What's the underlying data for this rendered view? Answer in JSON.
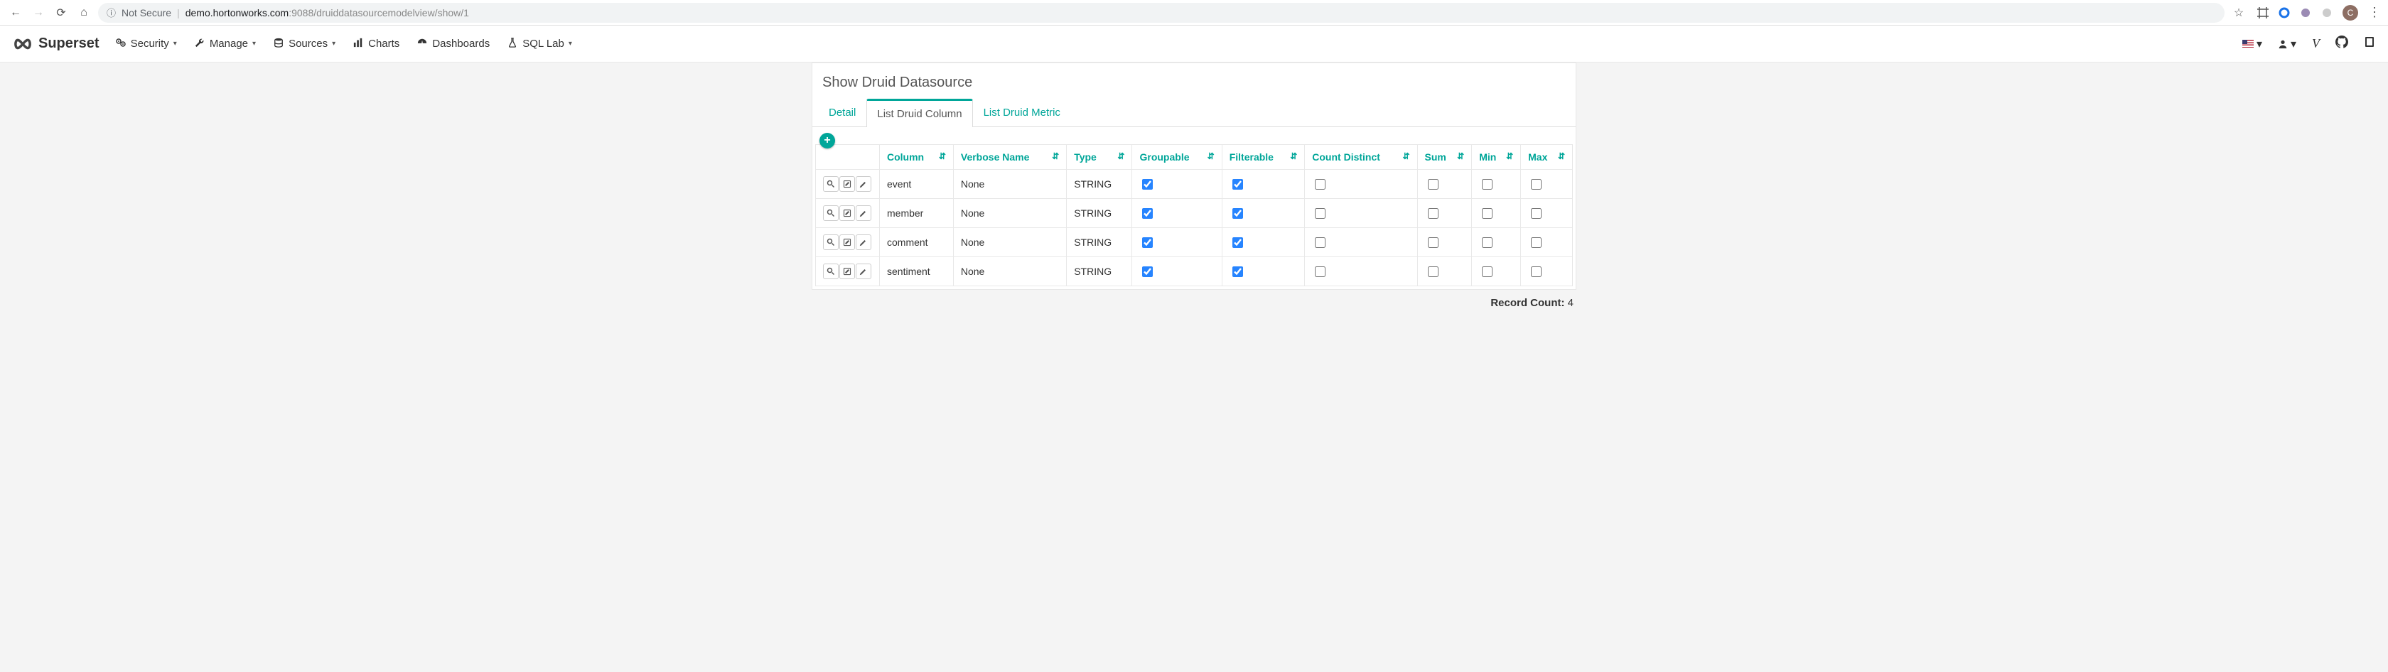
{
  "browser": {
    "not_secure": "Not Secure",
    "domain": "demo.hortonworks.com",
    "port_path": ":9088/druiddatasourcemodelview/show/1",
    "avatar_letter": "C"
  },
  "nav": {
    "brand": "Superset",
    "items": [
      {
        "label": "Security",
        "icon": "cogs"
      },
      {
        "label": "Manage",
        "icon": "wrench"
      },
      {
        "label": "Sources",
        "icon": "database"
      },
      {
        "label": "Charts",
        "icon": "bar-chart"
      },
      {
        "label": "Dashboards",
        "icon": "dashboard"
      },
      {
        "label": "SQL Lab",
        "icon": "flask"
      }
    ]
  },
  "page": {
    "title": "Show Druid Datasource",
    "tabs": [
      {
        "label": "Detail",
        "active": false
      },
      {
        "label": "List Druid Column",
        "active": true
      },
      {
        "label": "List Druid Metric",
        "active": false
      }
    ]
  },
  "table": {
    "headers": [
      "Column",
      "Verbose Name",
      "Type",
      "Groupable",
      "Filterable",
      "Count Distinct",
      "Sum",
      "Min",
      "Max"
    ],
    "rows": [
      {
        "column": "event",
        "verbose": "None",
        "type": "STRING",
        "groupable": true,
        "filterable": true,
        "count_distinct": false,
        "sum": false,
        "min": false,
        "max": false
      },
      {
        "column": "member",
        "verbose": "None",
        "type": "STRING",
        "groupable": true,
        "filterable": true,
        "count_distinct": false,
        "sum": false,
        "min": false,
        "max": false
      },
      {
        "column": "comment",
        "verbose": "None",
        "type": "STRING",
        "groupable": true,
        "filterable": true,
        "count_distinct": false,
        "sum": false,
        "min": false,
        "max": false
      },
      {
        "column": "sentiment",
        "verbose": "None",
        "type": "STRING",
        "groupable": true,
        "filterable": true,
        "count_distinct": false,
        "sum": false,
        "min": false,
        "max": false
      }
    ],
    "record_count_label": "Record Count:",
    "record_count": "4"
  }
}
